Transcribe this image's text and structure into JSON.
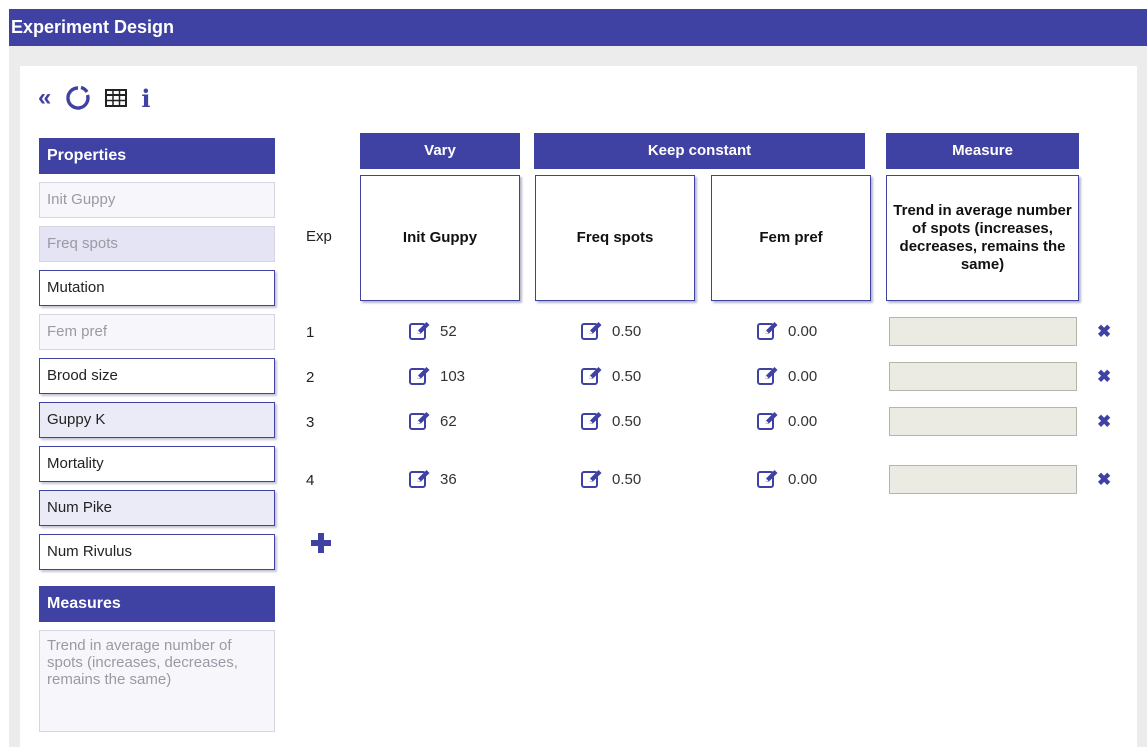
{
  "window": {
    "title": "Experiment Design"
  },
  "toolbar": {
    "collapse_glyph": "«",
    "icons": [
      "double-chevron-left-icon",
      "refresh-icon",
      "table-icon",
      "info-icon"
    ],
    "info_glyph": "i"
  },
  "sidebar": {
    "properties_header": "Properties",
    "properties": [
      {
        "label": "Init Guppy",
        "state": "disabled"
      },
      {
        "label": "Freq spots",
        "state": "selected"
      },
      {
        "label": "Mutation",
        "state": "active"
      },
      {
        "label": "Fem pref",
        "state": "disabled"
      },
      {
        "label": "Brood size",
        "state": "active"
      },
      {
        "label": "Guppy K",
        "state": "active"
      },
      {
        "label": "Mortality",
        "state": "active"
      },
      {
        "label": "Num Pike",
        "state": "active"
      },
      {
        "label": "Num Rivulus",
        "state": "active"
      }
    ],
    "measures_header": "Measures",
    "measure_item": "Trend in average number of spots (increases, decreases, remains the same)"
  },
  "table": {
    "groups": {
      "vary": "Vary",
      "constant": "Keep constant",
      "measure": "Measure"
    },
    "exp_label": "Exp",
    "columns": {
      "vary": "Init Guppy",
      "const1": "Freq spots",
      "const2": "Fem pref",
      "measure": "Trend in average number of spots (increases, decreases, remains the same)"
    },
    "rows": [
      {
        "n": "1",
        "vary": "52",
        "const1": "0.50",
        "const2": "0.00",
        "measure": ""
      },
      {
        "n": "2",
        "vary": "103",
        "const1": "0.50",
        "const2": "0.00",
        "measure": ""
      },
      {
        "n": "3",
        "vary": "62",
        "const1": "0.50",
        "const2": "0.00",
        "measure": ""
      },
      {
        "n": "4",
        "vary": "36",
        "const1": "0.50",
        "const2": "0.00",
        "measure": ""
      }
    ],
    "delete_glyph": "✖"
  },
  "colors": {
    "accent": "#3f41a3",
    "panel_bg": "#ececec",
    "input_bg": "#ebebe4"
  }
}
